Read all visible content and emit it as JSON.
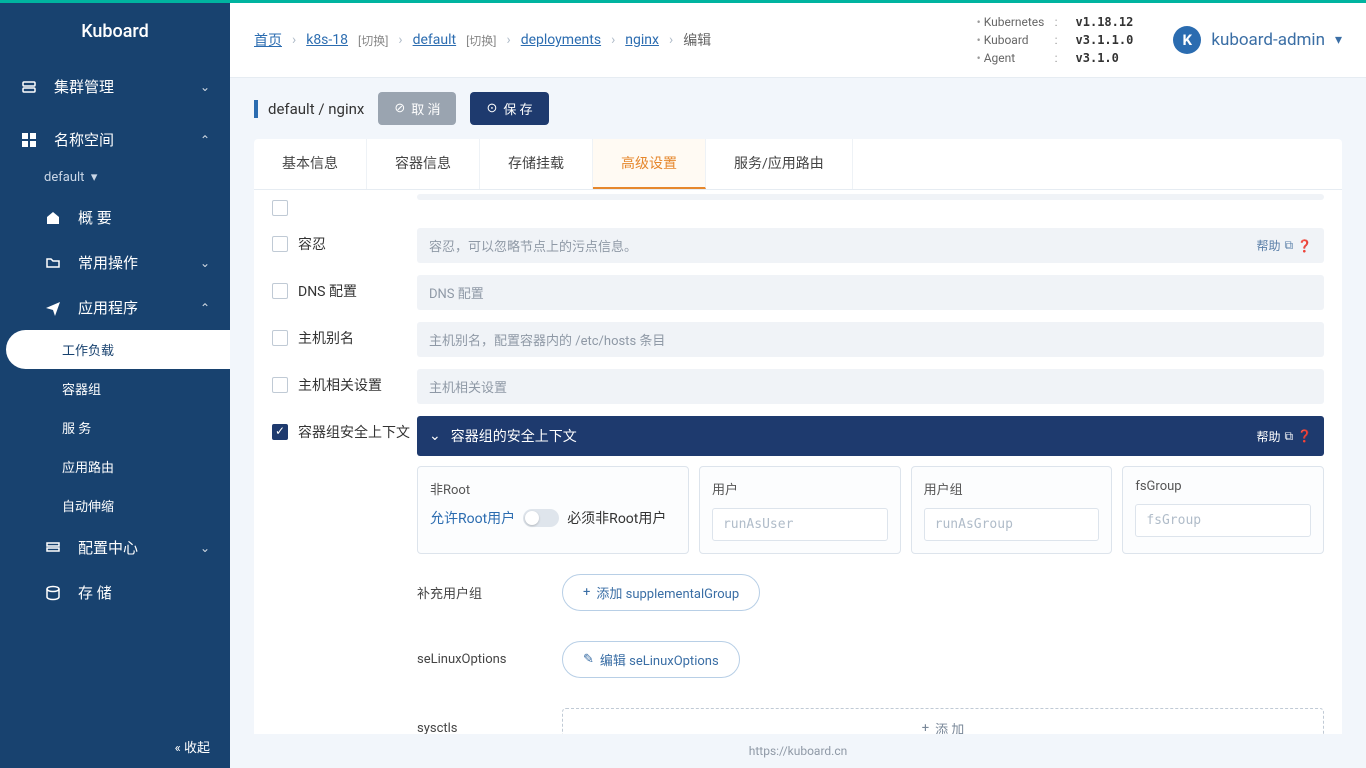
{
  "logo": "Kuboard",
  "sidebar": {
    "items": [
      {
        "label": "集群管理",
        "icon": "layers"
      },
      {
        "label": "名称空间",
        "icon": "grid"
      }
    ],
    "ns": "default",
    "subs": [
      {
        "label": "概 要",
        "icon": "home"
      },
      {
        "label": "常用操作",
        "icon": "folder"
      },
      {
        "label": "应用程序",
        "icon": "send"
      }
    ],
    "appsubs": [
      "工作负载",
      "容器组",
      "服 务",
      "应用路由",
      "自动伸缩"
    ],
    "bottom": [
      {
        "label": "配置中心",
        "icon": "sliders"
      },
      {
        "label": "存 储",
        "icon": "disk"
      }
    ],
    "collapse": "收起"
  },
  "breadcrumb": {
    "home": "首页",
    "cluster": "k8s-18",
    "switch": "[切换]",
    "ns": "default",
    "kind": "deployments",
    "name": "nginx",
    "action": "编辑"
  },
  "versions": [
    {
      "k": "Kubernetes",
      "v": "v1.18.12"
    },
    {
      "k": "Kuboard",
      "v": "v3.1.1.0"
    },
    {
      "k": "Agent",
      "v": "v3.1.0"
    }
  ],
  "user": {
    "initial": "K",
    "name": "kuboard-admin"
  },
  "header": {
    "title": "default / nginx",
    "cancel": "取 消",
    "save": "保 存"
  },
  "tabs": [
    "基本信息",
    "容器信息",
    "存储挂载",
    "高级设置",
    "服务/应用路由"
  ],
  "rows": {
    "toleration": {
      "label": "容忍",
      "placeholder": "容忍，可以忽略节点上的污点信息。",
      "help": "帮助"
    },
    "dns": {
      "label": "DNS 配置",
      "placeholder": "DNS 配置"
    },
    "hostalias": {
      "label": "主机别名",
      "placeholder": "主机别名，配置容器内的 /etc/hosts 条目"
    },
    "hostset": {
      "label": "主机相关设置",
      "placeholder": "主机相关设置"
    },
    "security": {
      "label": "容器组安全上下文",
      "header": "容器组的安全上下文",
      "help": "帮助"
    }
  },
  "security": {
    "nonroot": {
      "title": "非Root",
      "left": "允许Root用户",
      "right": "必须非Root用户"
    },
    "user": {
      "title": "用户",
      "placeholder": "runAsUser"
    },
    "group": {
      "title": "用户组",
      "placeholder": "runAsGroup"
    },
    "fsgroup": {
      "title": "fsGroup",
      "placeholder": "fsGroup"
    },
    "supp": {
      "label": "补充用户组",
      "btn": "添加 supplementalGroup"
    },
    "selinux": {
      "label": "seLinuxOptions",
      "btn": "编辑 seLinuxOptions"
    },
    "sysctls": {
      "label": "sysctls",
      "btn": "添 加"
    }
  },
  "footer": "https://kuboard.cn"
}
